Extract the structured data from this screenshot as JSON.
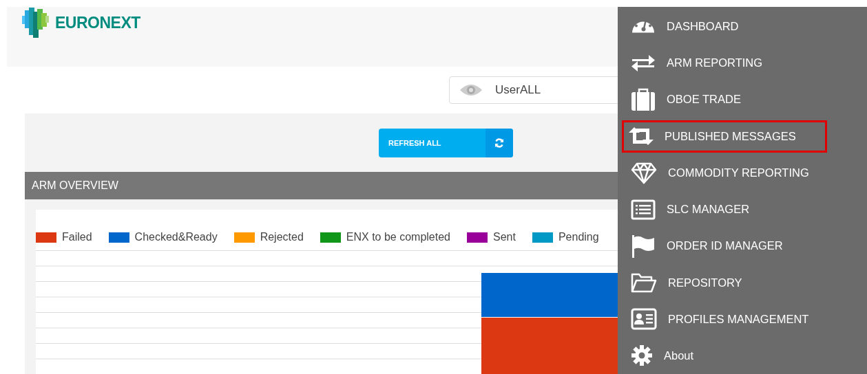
{
  "header": {
    "logo": "EURONEXT"
  },
  "user_field": {
    "value": "UserALL"
  },
  "refresh_button": {
    "label": "REFRESH ALL"
  },
  "overview": {
    "title": "ARM OVERVIEW",
    "legend": [
      {
        "label": "Failed",
        "color": "#dc3912"
      },
      {
        "label": "Checked&Ready",
        "color": "#0066cc"
      },
      {
        "label": "Rejected",
        "color": "#ff9900"
      },
      {
        "label": "ENX to be completed",
        "color": "#109618"
      },
      {
        "label": "Sent",
        "color": "#990099"
      },
      {
        "label": "Pending",
        "color": "#0099c6"
      }
    ]
  },
  "menu": {
    "items": [
      {
        "label": "DASHBOARD",
        "kind": "gauge",
        "selected": false
      },
      {
        "label": "ARM REPORTING",
        "kind": "arrows",
        "selected": false
      },
      {
        "label": "OBOE TRADE",
        "kind": "briefcase",
        "selected": false
      },
      {
        "label": "PUBLISHED MESSAGES",
        "kind": "retweet",
        "selected": true
      },
      {
        "label": "COMMODITY REPORTING",
        "kind": "diamond",
        "selected": false
      },
      {
        "label": "SLC MANAGER",
        "kind": "list",
        "selected": false
      },
      {
        "label": "ORDER ID MANAGER",
        "kind": "flag",
        "selected": false
      },
      {
        "label": "REPOSITORY",
        "kind": "folder",
        "selected": false
      },
      {
        "label": "PROFILES MANAGEMENT",
        "kind": "card",
        "selected": false
      },
      {
        "label": "About",
        "kind": "gear",
        "selected": false
      }
    ]
  }
}
